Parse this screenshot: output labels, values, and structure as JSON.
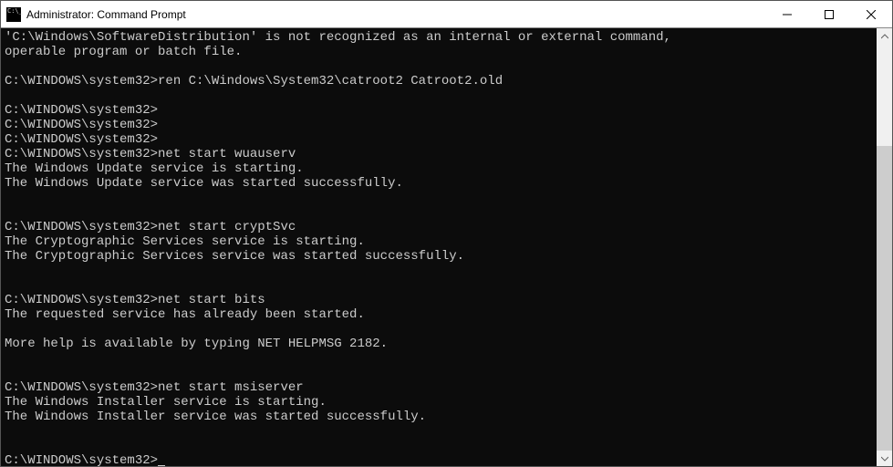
{
  "window": {
    "title": "Administrator: Command Prompt"
  },
  "terminal": {
    "prompt": "C:\\WINDOWS\\system32>",
    "lines": [
      "'C:\\Windows\\SoftwareDistribution' is not recognized as an internal or external command,",
      "operable program or batch file.",
      "",
      "C:\\WINDOWS\\system32>ren C:\\Windows\\System32\\catroot2 Catroot2.old",
      "",
      "C:\\WINDOWS\\system32>",
      "C:\\WINDOWS\\system32>",
      "C:\\WINDOWS\\system32>",
      "C:\\WINDOWS\\system32>net start wuauserv",
      "The Windows Update service is starting.",
      "The Windows Update service was started successfully.",
      "",
      "",
      "C:\\WINDOWS\\system32>net start cryptSvc",
      "The Cryptographic Services service is starting.",
      "The Cryptographic Services service was started successfully.",
      "",
      "",
      "C:\\WINDOWS\\system32>net start bits",
      "The requested service has already been started.",
      "",
      "More help is available by typing NET HELPMSG 2182.",
      "",
      "",
      "C:\\WINDOWS\\system32>net start msiserver",
      "The Windows Installer service is starting.",
      "The Windows Installer service was started successfully.",
      "",
      ""
    ]
  }
}
